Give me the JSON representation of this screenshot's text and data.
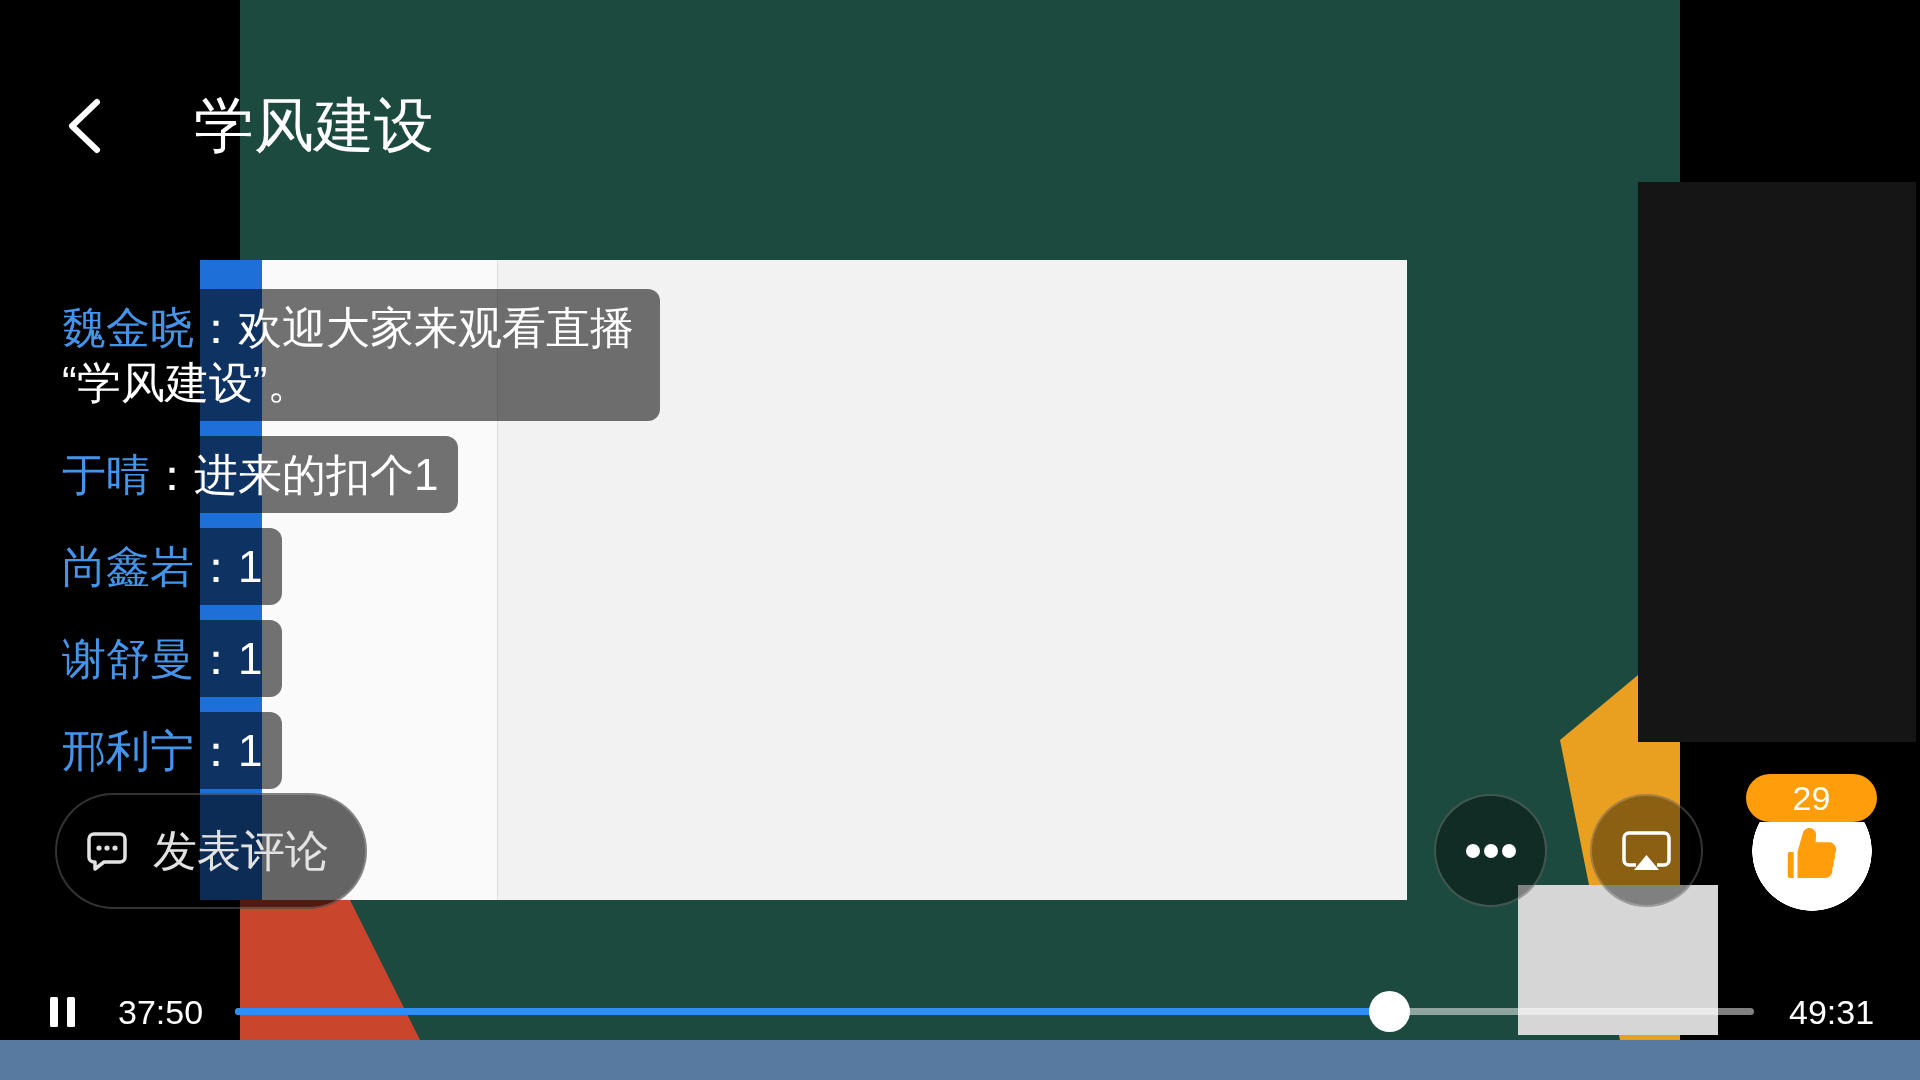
{
  "header": {
    "title": "学风建设"
  },
  "comments": [
    {
      "name": "魏金晓",
      "text": "：欢迎大家来观看直播“学风建设”。"
    },
    {
      "name": "于晴",
      "text": "：进来的扣个1"
    },
    {
      "name": "尚鑫岩",
      "text": "：1"
    },
    {
      "name": "谢舒曼",
      "text": "：1"
    },
    {
      "name": "邢利宁",
      "text": "：1"
    }
  ],
  "comment_button": {
    "label": "发表评论"
  },
  "like": {
    "count": "29"
  },
  "player": {
    "playing": true,
    "current_time": "37:50",
    "duration": "49:31",
    "progress": {
      "level": 0.76
    }
  }
}
